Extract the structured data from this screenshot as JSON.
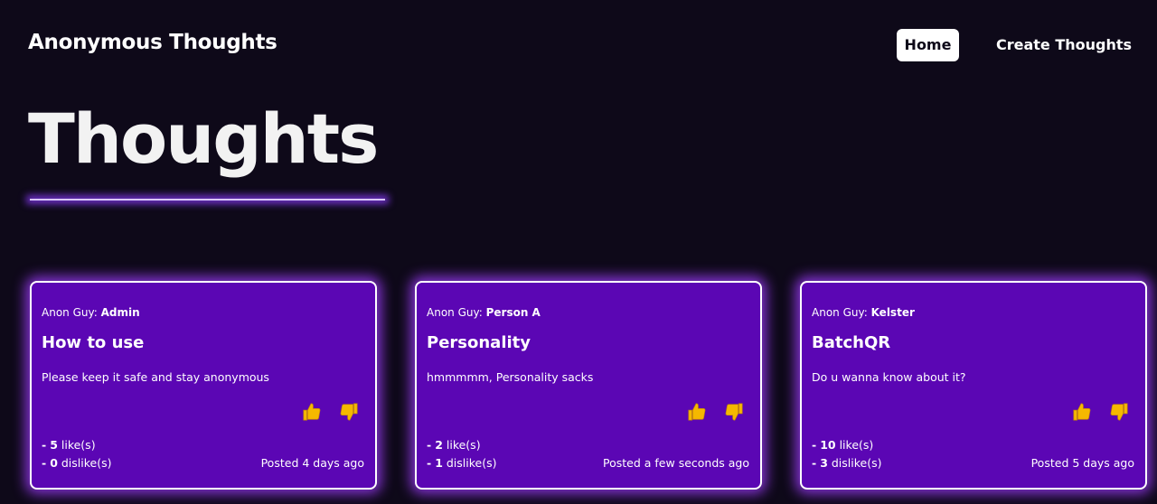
{
  "nav": {
    "brand": "Anonymous Thoughts",
    "home": "Home",
    "create": "Create Thoughts"
  },
  "page": {
    "title": "Thoughts"
  },
  "colors": {
    "background": "#0e0919",
    "card": "#5b06b4",
    "glow": "#a03cff",
    "thumb": "#f5b800"
  },
  "icons": {
    "like": "thumbs-up-icon",
    "dislike": "thumbs-down-icon"
  },
  "cards": [
    {
      "author_prefix": "Anon Guy:",
      "author": "Admin",
      "title": "How to use",
      "body": "Please keep it safe and stay anonymous",
      "likes_prefix": "-",
      "likes": "5",
      "likes_label": "like(s)",
      "dislikes_prefix": "-",
      "dislikes": "0",
      "dislikes_label": "dislike(s)",
      "posted": "Posted 4 days ago"
    },
    {
      "author_prefix": "Anon Guy:",
      "author": "Person A",
      "title": "Personality",
      "body": "hmmmmm, Personality sacks",
      "likes_prefix": "-",
      "likes": "2",
      "likes_label": "like(s)",
      "dislikes_prefix": "-",
      "dislikes": "1",
      "dislikes_label": "dislike(s)",
      "posted": "Posted a few seconds ago"
    },
    {
      "author_prefix": "Anon Guy:",
      "author": "Kelster",
      "title": "BatchQR",
      "body": "Do u wanna know about it?",
      "likes_prefix": "-",
      "likes": "10",
      "likes_label": "like(s)",
      "dislikes_prefix": "-",
      "dislikes": "3",
      "dislikes_label": "dislike(s)",
      "posted": "Posted 5 days ago"
    }
  ]
}
